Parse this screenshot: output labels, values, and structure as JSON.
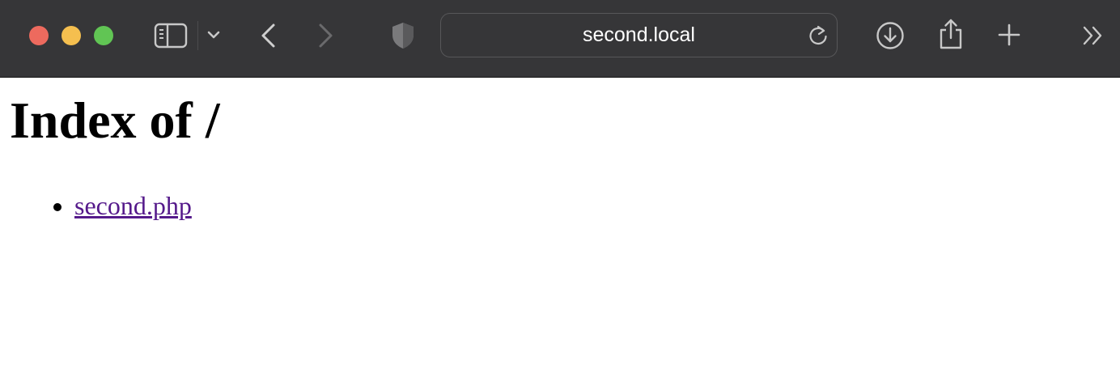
{
  "browser": {
    "address_bar": {
      "url": "second.local"
    },
    "icons": {
      "sidebar": "sidebar-icon",
      "tab_overview_menu": "chevron-down-icon",
      "back": "chevron-left-icon",
      "forward": "chevron-right-icon",
      "privacy": "shield-icon",
      "reload": "reload-icon",
      "downloads": "download-icon",
      "share": "share-icon",
      "new_tab": "plus-icon",
      "more": "double-chevron-right-icon"
    },
    "colors": {
      "toolbar_bg": "#363638",
      "close": "#ed6a5e",
      "minimize": "#f5bf4f",
      "zoom": "#61c554"
    }
  },
  "page": {
    "heading": "Index of /",
    "files": [
      {
        "name": "second.php"
      }
    ],
    "link_color": "#551a8b"
  }
}
